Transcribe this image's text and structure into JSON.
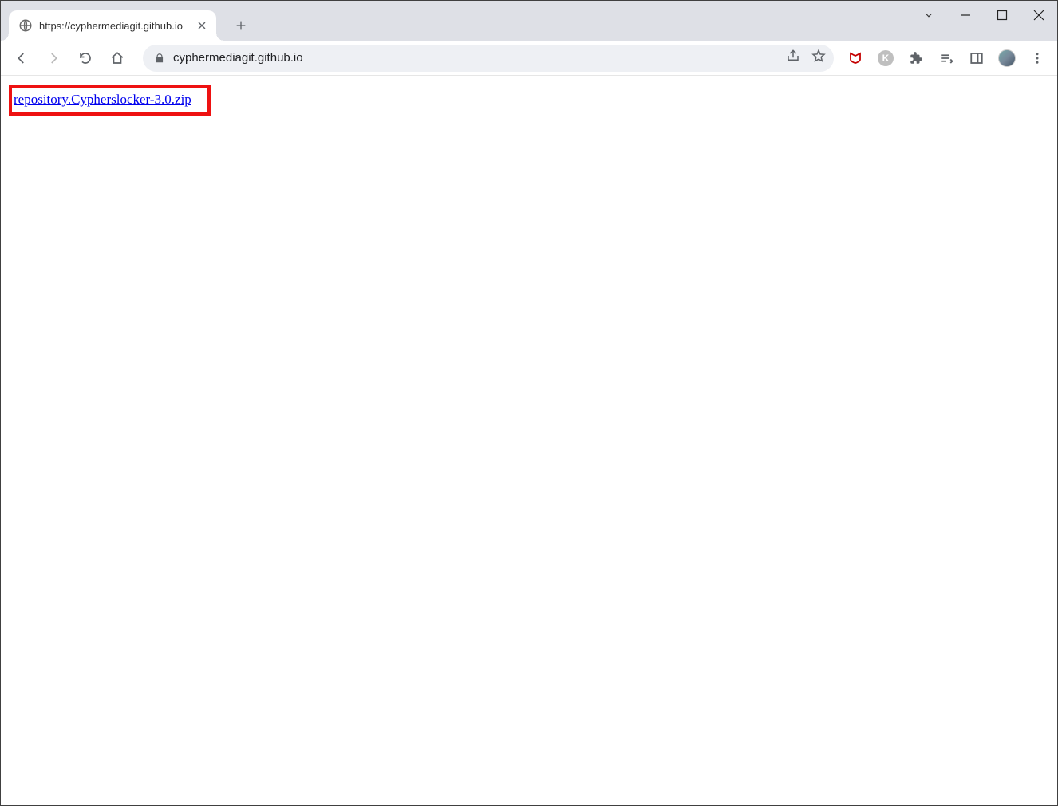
{
  "window": {
    "tab_title": "https://cyphermediagit.github.io",
    "search_tabs_tooltip": "Search tabs"
  },
  "toolbar": {
    "url": "cyphermediagit.github.io"
  },
  "page": {
    "download_link_text": "repository.Cypherslocker-3.0.zip"
  },
  "extensions": {
    "k_badge_letter": "K"
  }
}
